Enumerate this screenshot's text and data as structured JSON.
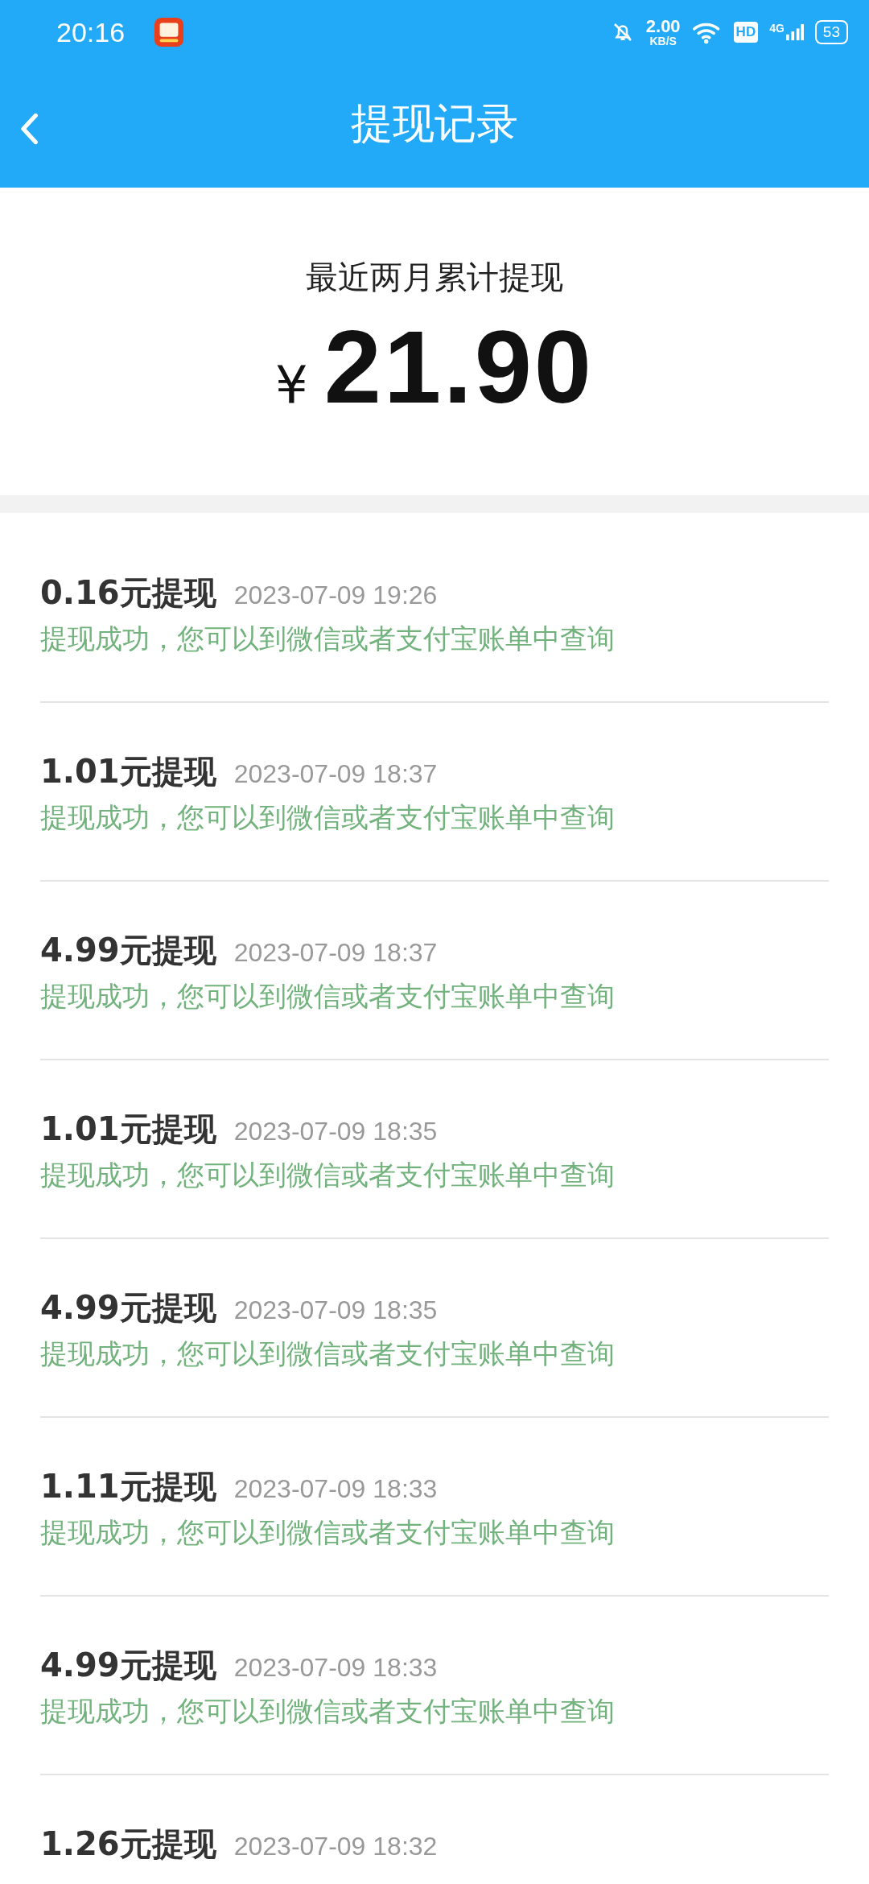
{
  "status_bar": {
    "time": "20:16",
    "net_speed": "2.00",
    "net_unit": "KB/S",
    "hd": "HD",
    "network": "4G",
    "battery": "53"
  },
  "header": {
    "title": "提现记录"
  },
  "summary": {
    "label": "最近两月累计提现",
    "currency": "¥",
    "amount": "21.90"
  },
  "records": [
    {
      "title": "0.16元提现",
      "time": "2023-07-09 19:26",
      "status": "提现成功，您可以到微信或者支付宝账单中查询"
    },
    {
      "title": "1.01元提现",
      "time": "2023-07-09 18:37",
      "status": "提现成功，您可以到微信或者支付宝账单中查询"
    },
    {
      "title": "4.99元提现",
      "time": "2023-07-09 18:37",
      "status": "提现成功，您可以到微信或者支付宝账单中查询"
    },
    {
      "title": "1.01元提现",
      "time": "2023-07-09 18:35",
      "status": "提现成功，您可以到微信或者支付宝账单中查询"
    },
    {
      "title": "4.99元提现",
      "time": "2023-07-09 18:35",
      "status": "提现成功，您可以到微信或者支付宝账单中查询"
    },
    {
      "title": "1.11元提现",
      "time": "2023-07-09 18:33",
      "status": "提现成功，您可以到微信或者支付宝账单中查询"
    },
    {
      "title": "4.99元提现",
      "time": "2023-07-09 18:33",
      "status": "提现成功，您可以到微信或者支付宝账单中查询"
    },
    {
      "title": "1.26元提现",
      "time": "2023-07-09 18:32"
    }
  ]
}
